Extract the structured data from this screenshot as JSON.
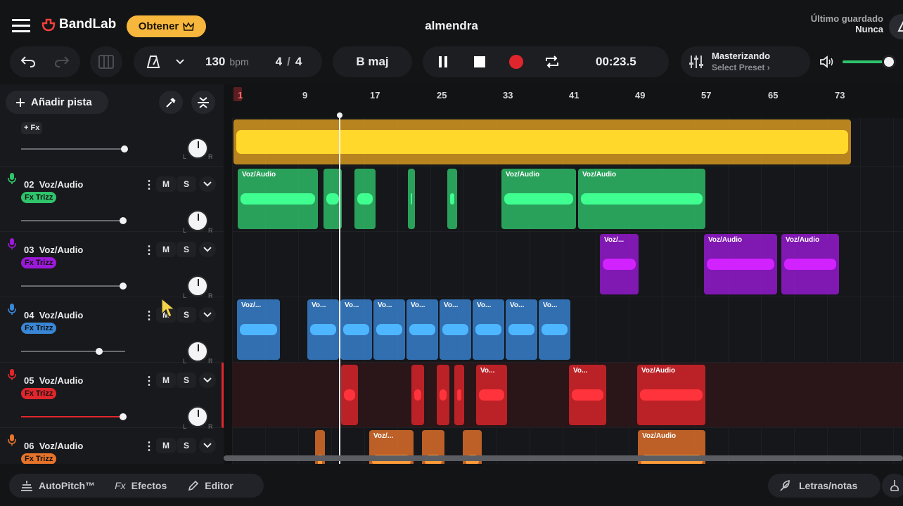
{
  "app": {
    "brand": "BandLab",
    "get_label": "Obtener",
    "project_title": "almendra",
    "last_saved_label": "Último guardado",
    "last_saved_value": "Nunca"
  },
  "transport": {
    "bpm_value": "130",
    "bpm_unit": "bpm",
    "time_sig_num": "4",
    "time_sig_sep": "/",
    "time_sig_den": "4",
    "key": "B maj",
    "time": "00:23.5"
  },
  "mastering": {
    "title": "Masterizando",
    "subtitle": "Select Preset"
  },
  "sidebar": {
    "add_track_label": "Añadir pista",
    "first_track_fx": "+ Fx"
  },
  "ruler": {
    "marks": [
      "1",
      "9",
      "17",
      "25",
      "33",
      "41",
      "49",
      "57",
      "65",
      "73"
    ]
  },
  "tracks": [
    {
      "num": "02",
      "name": "Voz/Audio",
      "fx": "Fx Trizz",
      "color": "#2fc46b",
      "volume": 0.98
    },
    {
      "num": "03",
      "name": "Voz/Audio",
      "fx": "Fx Trizz",
      "color": "#9b19d8",
      "volume": 0.98
    },
    {
      "num": "04",
      "name": "Voz/Audio",
      "fx": "Fx Trizz",
      "color": "#3a86d6",
      "volume": 0.75
    },
    {
      "num": "05",
      "name": "Voz/Audio",
      "fx": "Fx Trizz",
      "color": "#e0262c",
      "volume": 0.98
    },
    {
      "num": "06",
      "name": "Voz/Audio",
      "fx": "Fx Trizz",
      "color": "#e6732a",
      "volume": 0.98
    }
  ],
  "mute_label": "M",
  "solo_label": "S",
  "pan_left": "L",
  "pan_right": "R",
  "clips": {
    "full": "Voz/Audio",
    "short": "Voz/...",
    "tiny": "Vo..."
  },
  "bottom": {
    "autopitch": "AutoPitch™",
    "fx_prefix": "Fx",
    "effects": "Efectos",
    "editor": "Editor",
    "lyrics": "Letras/notas"
  },
  "colors": {
    "accent": "#f6b73c",
    "track01": "#e0a020",
    "red": "#e0262c"
  }
}
